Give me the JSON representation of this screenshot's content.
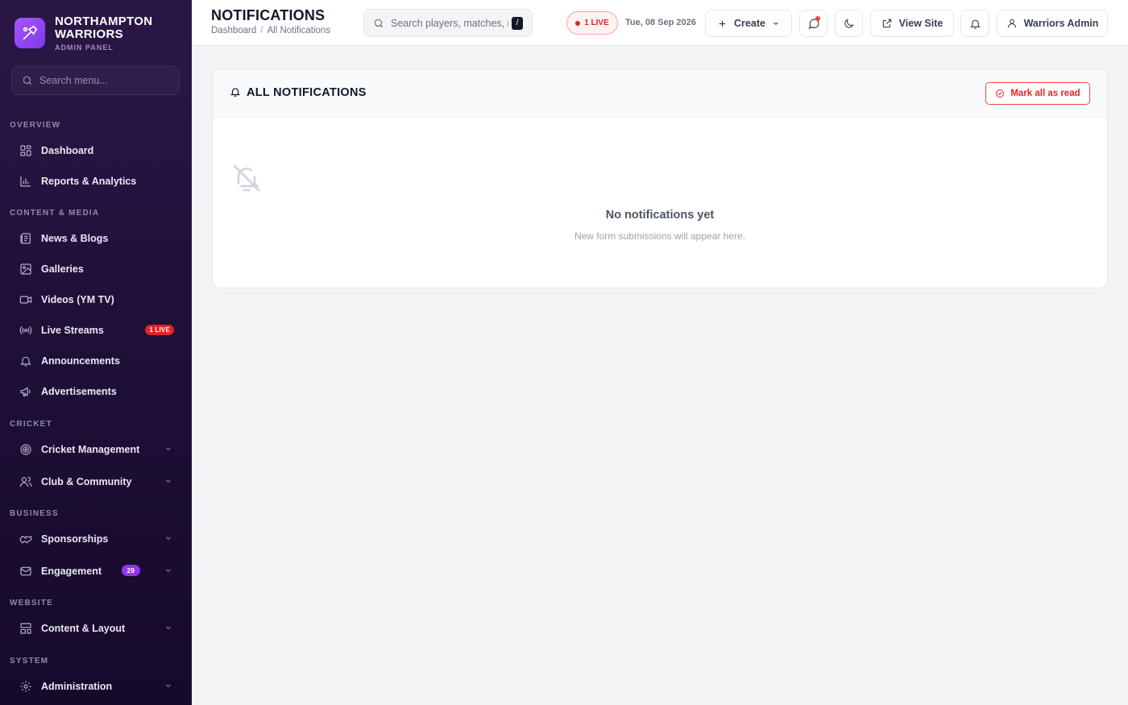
{
  "brand": {
    "name_line1": "NORTHAMPTON",
    "name_line2": "WARRIORS",
    "subtitle": "ADMIN PANEL",
    "logo_icon": "cricket-bat-logo"
  },
  "sidebar": {
    "search_placeholder": "Search menu...",
    "sections": {
      "overview": "OVERVIEW",
      "content": "CONTENT & MEDIA",
      "cricket": "CRICKET",
      "business": "BUSINESS",
      "website": "WEBSITE",
      "system": "SYSTEM"
    },
    "items": {
      "dashboard": "Dashboard",
      "reports": "Reports & Analytics",
      "news": "News & Blogs",
      "galleries": "Galleries",
      "videos": "Videos (YM TV)",
      "live": "Live Streams",
      "live_badge": "1 LIVE",
      "announcements": "Announcements",
      "ads": "Advertisements",
      "cricket_mgmt": "Cricket Management",
      "club": "Club & Community",
      "sponsorships": "Sponsorships",
      "engagement": "Engagement",
      "engagement_badge": "29",
      "content_layout": "Content & Layout",
      "administration": "Administration"
    }
  },
  "header": {
    "title": "NOTIFICATIONS",
    "breadcrumb": [
      "Dashboard",
      "All Notifications"
    ],
    "search_placeholder": "Search players, matches, n",
    "search_shortcut": "/",
    "live_label": "1 LIVE",
    "date": "Tue, 08 Sep 2026",
    "create_label": "Create",
    "view_site_label": "View Site",
    "user_label": "Warriors Admin"
  },
  "main": {
    "card_title": "ALL NOTIFICATIONS",
    "mark_all_label": "Mark all as read",
    "empty_title": "No notifications yet",
    "empty_subtitle": "New form submissions will appear here."
  },
  "colors": {
    "live_red": "#dc2626",
    "brand_purple": "#9333ea",
    "sidebar_bg": "#1f1038"
  }
}
